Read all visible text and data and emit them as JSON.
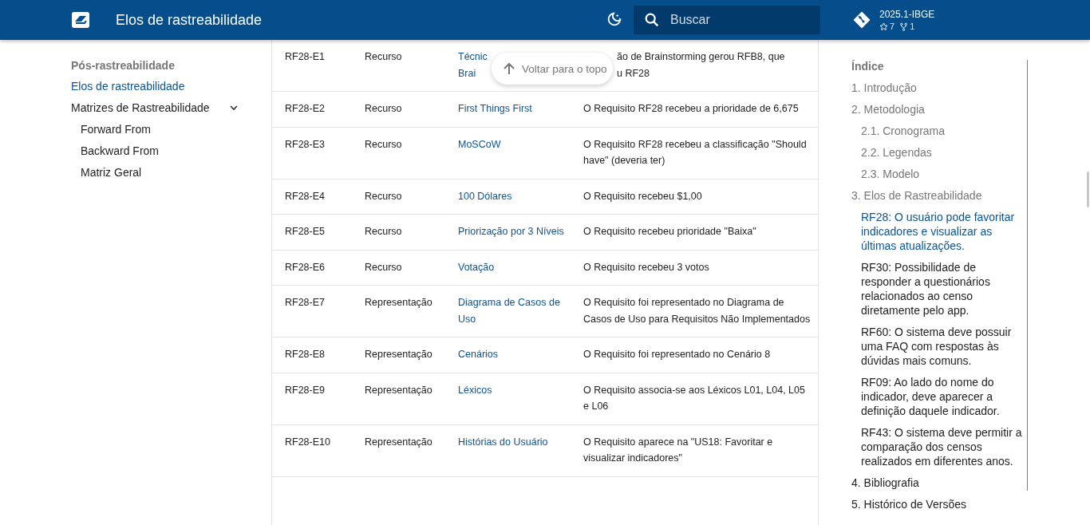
{
  "header": {
    "title": "Elos de rastreabilidade",
    "search": {
      "placeholder": "Buscar"
    },
    "repo": {
      "name": "2025.1-IBGE",
      "stars": "7",
      "forks": "1"
    }
  },
  "nav": {
    "section": "Pós-rastreabilidade",
    "items": [
      {
        "label": "Elos de rastreabilidade",
        "selected": true
      },
      {
        "label": "Matrizes de Rastreabilidade",
        "selected": false,
        "expanded": true,
        "children": [
          {
            "label": "Forward From",
            "selected": false
          },
          {
            "label": "Backward From",
            "selected": false
          },
          {
            "label": "Matriz Geral",
            "selected": false
          }
        ]
      }
    ]
  },
  "table": {
    "rows": [
      {
        "kind": "covered",
        "id": "RF28-E1",
        "type": "Recurso",
        "technique": [
          "Técnic",
          "Brai"
        ],
        "description": [
          "ão de Brainstorming gerou RFB8, que",
          "u RF28"
        ]
      },
      {
        "kind": "full",
        "id": "RF28-E2",
        "type": "Recurso",
        "technique": "First Things First",
        "description": "O Requisito RF28 recebeu a prioridade de 6,675"
      },
      {
        "kind": "full",
        "id": "RF28-E3",
        "type": "Recurso",
        "technique": "MoSCoW",
        "description": "O Requisito RF28 recebeu a classificação \"Should have\" (deveria ter)"
      },
      {
        "kind": "full",
        "id": "RF28-E4",
        "type": "Recurso",
        "technique": "100 Dólares",
        "description": "O Requisito recebeu $1,00"
      },
      {
        "kind": "full",
        "id": "RF28-E5",
        "type": "Recurso",
        "technique": "Priorização por 3 Níveis",
        "description": "O Requisito recebeu prioridade \"Baixa\""
      },
      {
        "kind": "full",
        "id": "RF28-E6",
        "type": "Recurso",
        "technique": "Votação",
        "description": "O Requisito recebeu 3 votos"
      },
      {
        "kind": "full",
        "id": "RF28-E7",
        "type": "Representação",
        "technique": "Diagrama de Casos de Uso",
        "description": "O Requisito foi representado no Diagrama de Casos de Uso para Requisitos Não Implementados"
      },
      {
        "kind": "full",
        "id": "RF28-E8",
        "type": "Representação",
        "technique": "Cenários",
        "description": "O Requisito foi representado no Cenário 8"
      },
      {
        "kind": "full",
        "id": "RF28-E9",
        "type": "Representação",
        "technique": "Léxicos",
        "description": "O Requisito associa-se aos Léxicos L01, L04, L05 e L06"
      },
      {
        "kind": "full",
        "id": "RF28-E10",
        "type": "Representação",
        "technique": "Histórias do Usuário",
        "description": "O Requisito aparece na \"US18: Favoritar e visualizar indicadores\""
      }
    ]
  },
  "back_to_top": {
    "label": "Voltar para o topo"
  },
  "toc": {
    "title": "Índice",
    "items": [
      {
        "label": "1. Introdução",
        "selected": false
      },
      {
        "label": "2. Metodologia",
        "selected": false,
        "children": [
          {
            "label": "2.1. Cronograma",
            "selected": false
          },
          {
            "label": "2.2. Legendas",
            "selected": false
          },
          {
            "label": "2.3. Modelo",
            "selected": false
          }
        ]
      },
      {
        "label": "3. Elos de Rastreabilidade",
        "selected": false,
        "children": [
          {
            "label": "RF28: O usuário pode favoritar indicadores e visualizar as últimas atualizações.",
            "selected": true
          },
          {
            "label": "RF30: Possibilidade de responder a questionários relacionados ao censo diretamente pelo app.",
            "selected": false
          },
          {
            "label": "RF60: O sistema deve possuir uma FAQ com respostas às dúvidas mais comuns.",
            "selected": false
          },
          {
            "label": "RF09: Ao lado do nome do indicador, deve aparecer a definição daquele indicador.",
            "selected": false
          },
          {
            "label": "RF43: O sistema deve permitir a comparação dos censos realizados em diferentes anos.",
            "selected": false
          }
        ]
      },
      {
        "label": "4. Bibliografia",
        "selected": false
      },
      {
        "label": "5. Histórico de Versões",
        "selected": false
      }
    ]
  }
}
